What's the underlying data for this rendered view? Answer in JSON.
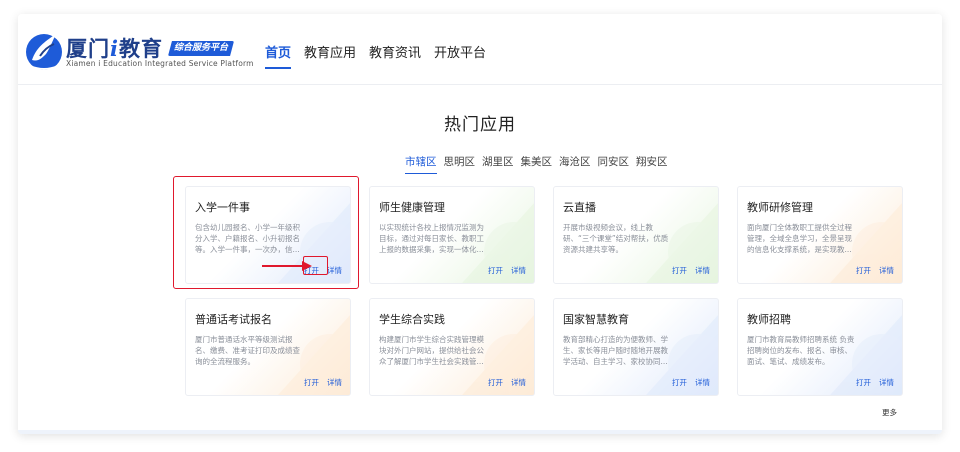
{
  "brand": {
    "name_pre": "厦门",
    "name_i": "i",
    "name_post": "教育",
    "badge": "综合服务平台",
    "subtitle": "Xiamen i Education Integrated Service Platform"
  },
  "nav": {
    "items": [
      {
        "label": "首页",
        "active": true
      },
      {
        "label": "教育应用",
        "active": false
      },
      {
        "label": "教育资讯",
        "active": false
      },
      {
        "label": "开放平台",
        "active": false
      }
    ]
  },
  "section": {
    "title": "热门应用",
    "more_label": "更多"
  },
  "districts": [
    {
      "label": "市辖区",
      "active": true
    },
    {
      "label": "思明区",
      "active": false
    },
    {
      "label": "湖里区",
      "active": false
    },
    {
      "label": "集美区",
      "active": false
    },
    {
      "label": "海沧区",
      "active": false
    },
    {
      "label": "同安区",
      "active": false
    },
    {
      "label": "翔安区",
      "active": false
    }
  ],
  "cards": [
    {
      "title": "入学一件事",
      "desc": "包含幼儿园报名、小学一年级积分入学、户籍报名、小升初报名等。入学一件事，一次办，信...",
      "open": "打开",
      "detail": "详情",
      "theme": "blue"
    },
    {
      "title": "师生健康管理",
      "desc": "以实现统计各校上报情况监测为目标，通过对每日家长、教职工上报的数据采集，实现一体化...",
      "open": "打开",
      "detail": "详情",
      "theme": "green"
    },
    {
      "title": "云直播",
      "desc": "开展市级视频会议，线上教研、“三个课堂”结对帮扶，优质资源共建共享等。",
      "open": "打开",
      "detail": "详情",
      "theme": "green"
    },
    {
      "title": "教师研修管理",
      "desc": "面向厦门全体教职工提供全过程管理，全域全息学习，全景呈现的信息化支撑系统，是实现教...",
      "open": "打开",
      "detail": "详情",
      "theme": "orange"
    },
    {
      "title": "普通话考试报名",
      "desc": "厦门市普通话水平等级测试报名、缴费、准考证打印及成绩查询的全流程服务。",
      "open": "打开",
      "detail": "详情",
      "theme": "orange"
    },
    {
      "title": "学生综合实践",
      "desc": "构建厦门市学生综合实践管理模块对外门户网站，提供给社会公众了解厦门市学生社会实践管...",
      "open": "打开",
      "detail": "详情",
      "theme": "orange"
    },
    {
      "title": "国家智慧教育",
      "desc": "教育部精心打造的为便教师、学生、家长等用户随时随地开展教学活动、自主学习、家校协同...",
      "open": "打开",
      "detail": "详情",
      "theme": "blue"
    },
    {
      "title": "教师招聘",
      "desc": "厦门市教育局教师招聘系统 负责招聘岗位的发布、报名、审核、面试、笔试、成绩发布。",
      "open": "打开",
      "detail": "详情",
      "theme": "blue"
    }
  ],
  "colors": {
    "accent": "#1e5bd8",
    "brand_dark": "#1f3f8a",
    "highlight": "#e0182d",
    "card_blue": "#dfe9fb",
    "card_green": "#e6f5df",
    "card_orange": "#fdebd7"
  },
  "icons": {
    "logo": "bird-logo-icon",
    "arrow": "red-arrow-icon"
  }
}
